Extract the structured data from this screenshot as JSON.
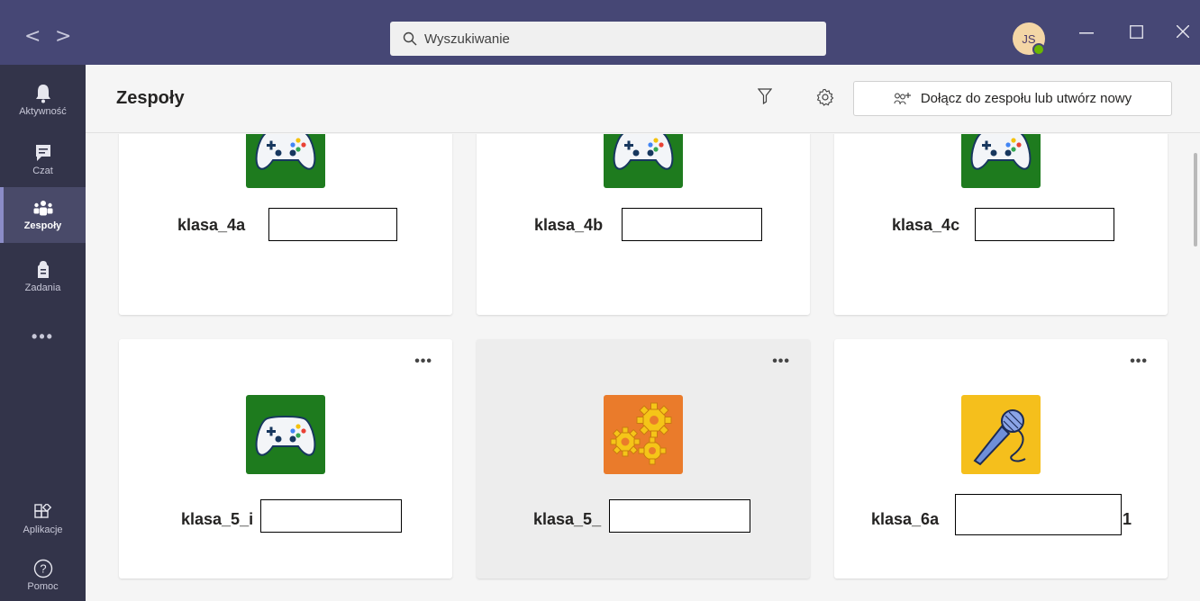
{
  "titlebar": {
    "back_glyph": "<",
    "forward_glyph": ">",
    "search_placeholder": "Wyszukiwanie",
    "avatar_initials": "JS",
    "presence_color": "#6bb700",
    "bg_color": "#464775"
  },
  "rail": {
    "items": [
      {
        "label": "Aktywność",
        "icon": "bell-icon"
      },
      {
        "label": "Czat",
        "icon": "chat-icon"
      },
      {
        "label": "Zespoły",
        "icon": "teams-icon",
        "active": true
      },
      {
        "label": "Zadania",
        "icon": "assignments-icon"
      },
      {
        "label": "Aplikacje",
        "icon": "apps-icon"
      },
      {
        "label": "Pomoc",
        "icon": "help-icon"
      }
    ],
    "more": "•••"
  },
  "header": {
    "title": "Zespoły",
    "join_label": "Dołącz do zespołu lub utwórz nowy"
  },
  "teams": [
    {
      "name": "klasa_4a",
      "icon": "gamepad-icon",
      "color": "#1e7b1e"
    },
    {
      "name": "klasa_4b",
      "icon": "gamepad-icon",
      "color": "#1e7b1e"
    },
    {
      "name": "klasa_4c",
      "icon": "gamepad-icon",
      "color": "#1e7b1e"
    },
    {
      "name": "klasa_5_i",
      "icon": "gamepad-icon",
      "color": "#1e7b1e",
      "more": "•••"
    },
    {
      "name": "klasa_5_",
      "icon": "gears-icon",
      "color": "#ea7b2b",
      "more": "•••"
    },
    {
      "name": "klasa_6a",
      "name_suffix": "1",
      "icon": "microphone-icon",
      "color": "#f5bf1c",
      "more": "•••"
    }
  ]
}
